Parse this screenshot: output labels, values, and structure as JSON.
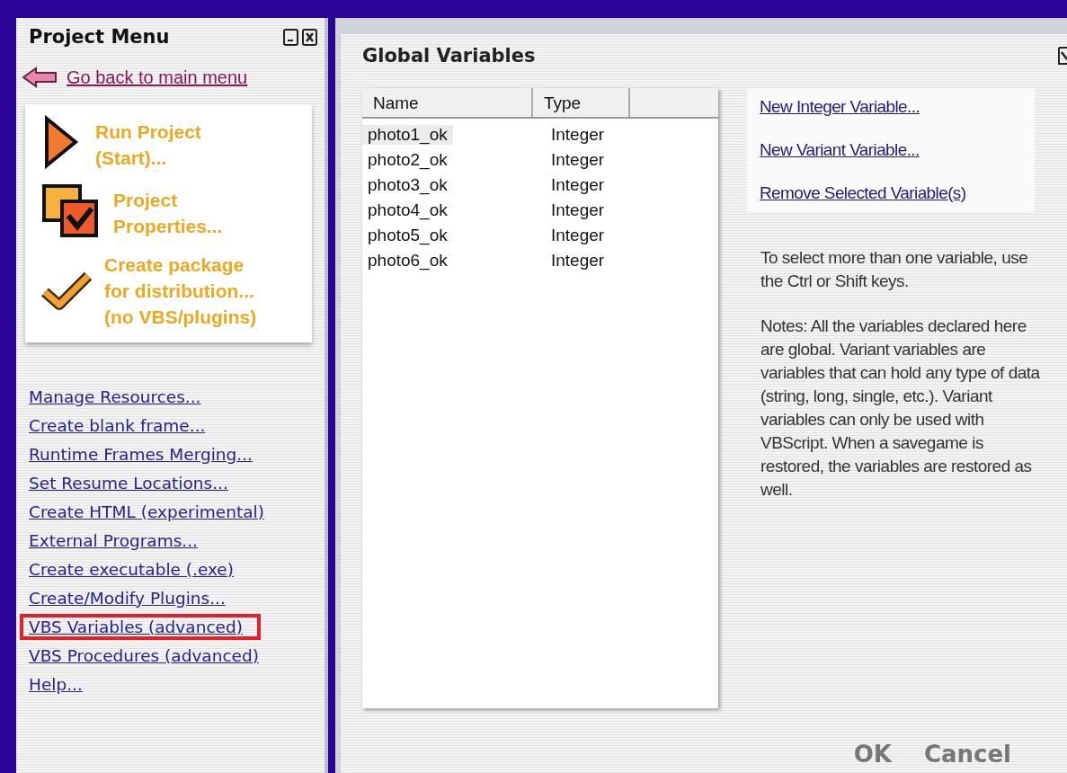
{
  "project_menu": {
    "title": "Project Menu",
    "back_link": "Go back to main menu",
    "actions": [
      {
        "kind": "run",
        "lines": [
          "Run Project",
          "(Start)..."
        ]
      },
      {
        "kind": "properties",
        "lines": [
          "Project",
          "Properties..."
        ]
      },
      {
        "kind": "package",
        "lines": [
          "Create package",
          "for distribution...",
          "(no VBS/plugins)"
        ]
      }
    ],
    "links": [
      {
        "label": "Manage Resources...",
        "highlighted": false
      },
      {
        "label": "Create blank frame...",
        "highlighted": false
      },
      {
        "label": "Runtime Frames Merging...",
        "highlighted": false
      },
      {
        "label": "Set Resume Locations...",
        "highlighted": false
      },
      {
        "label": "Create HTML (experimental)",
        "highlighted": false
      },
      {
        "label": "External Programs...",
        "highlighted": false
      },
      {
        "label": "Create executable (.exe)",
        "highlighted": false
      },
      {
        "label": "Create/Modify Plugins...",
        "highlighted": false
      },
      {
        "label": "VBS Variables (advanced)",
        "highlighted": true
      },
      {
        "label": "VBS Procedures (advanced)",
        "highlighted": false
      },
      {
        "label": "Help...",
        "highlighted": false
      }
    ]
  },
  "dialog": {
    "title": "Global Variables",
    "table": {
      "columns": [
        "Name",
        "Type"
      ],
      "rows": [
        {
          "name": "photo1_ok",
          "type": "Integer",
          "selected": true
        },
        {
          "name": "photo2_ok",
          "type": "Integer",
          "selected": false
        },
        {
          "name": "photo3_ok",
          "type": "Integer",
          "selected": false
        },
        {
          "name": "photo4_ok",
          "type": "Integer",
          "selected": false
        },
        {
          "name": "photo5_ok",
          "type": "Integer",
          "selected": false
        },
        {
          "name": "photo6_ok",
          "type": "Integer",
          "selected": false
        }
      ]
    },
    "actions": [
      "New Integer Variable...",
      "New Variant Variable...",
      "Remove Selected Variable(s)"
    ],
    "hint": "To select more than one variable, use the Ctrl or Shift keys.",
    "notes": "Notes: All the variables declared here are global. Variant variables are variables that can hold any type of data (string, long, single, etc.). Variant variables can only be used with VBScript.   When a savegame is restored, the variables are restored as well.",
    "buttons": [
      "OK",
      "Cancel"
    ]
  }
}
